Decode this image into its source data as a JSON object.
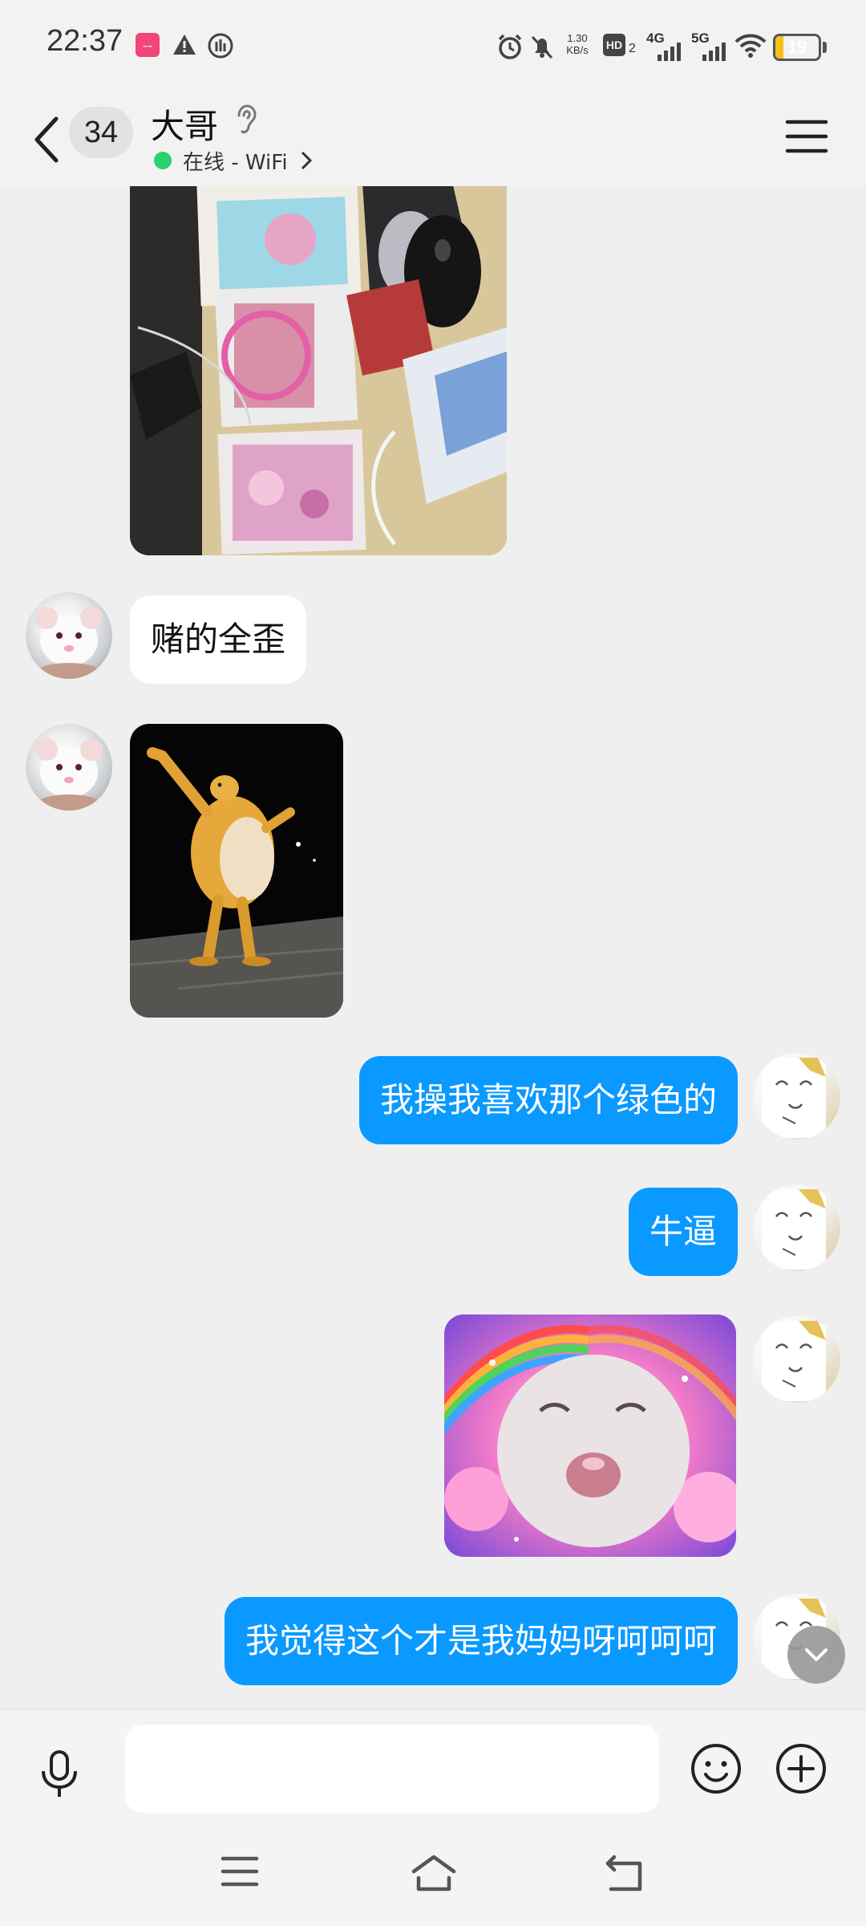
{
  "status_bar": {
    "time": "22:37",
    "net_speed_value": "1.30",
    "net_speed_unit": "KB/s",
    "hd_label": "HD",
    "hd_sub": "2",
    "net_4g": "4G",
    "net_5g": "5G",
    "battery_level": "19",
    "battery_fraction": 0.19,
    "icons": [
      "app-notification-icon",
      "warning-icon",
      "vpn-icon",
      "alarm-icon",
      "mute-icon",
      "signal-icon",
      "wifi-icon",
      "battery-icon"
    ]
  },
  "header": {
    "unread_count": "34",
    "title": "大哥",
    "online_status": "在线 - WiFi",
    "status_color": "#2bd16b"
  },
  "messages": [
    {
      "side": "left",
      "type": "image",
      "desc_icon": "photo-desk-image"
    },
    {
      "side": "left",
      "type": "text",
      "text": "赌的全歪"
    },
    {
      "side": "left",
      "type": "image",
      "desc_icon": "sticker-dancing-figure"
    },
    {
      "side": "right",
      "type": "text",
      "text": "我操我喜欢那个绿色的"
    },
    {
      "side": "right",
      "type": "text",
      "text": "牛逼"
    },
    {
      "side": "right",
      "type": "image",
      "desc_icon": "sticker-rainbow-rat"
    },
    {
      "side": "right",
      "type": "text",
      "text": "我觉得这个才是我妈妈呀呵呵呵"
    }
  ],
  "input": {
    "value": "",
    "placeholder": ""
  },
  "colors": {
    "outgoing_bubble": "#0a99ff",
    "incoming_bubble": "#ffffff",
    "background": "#efefef"
  }
}
